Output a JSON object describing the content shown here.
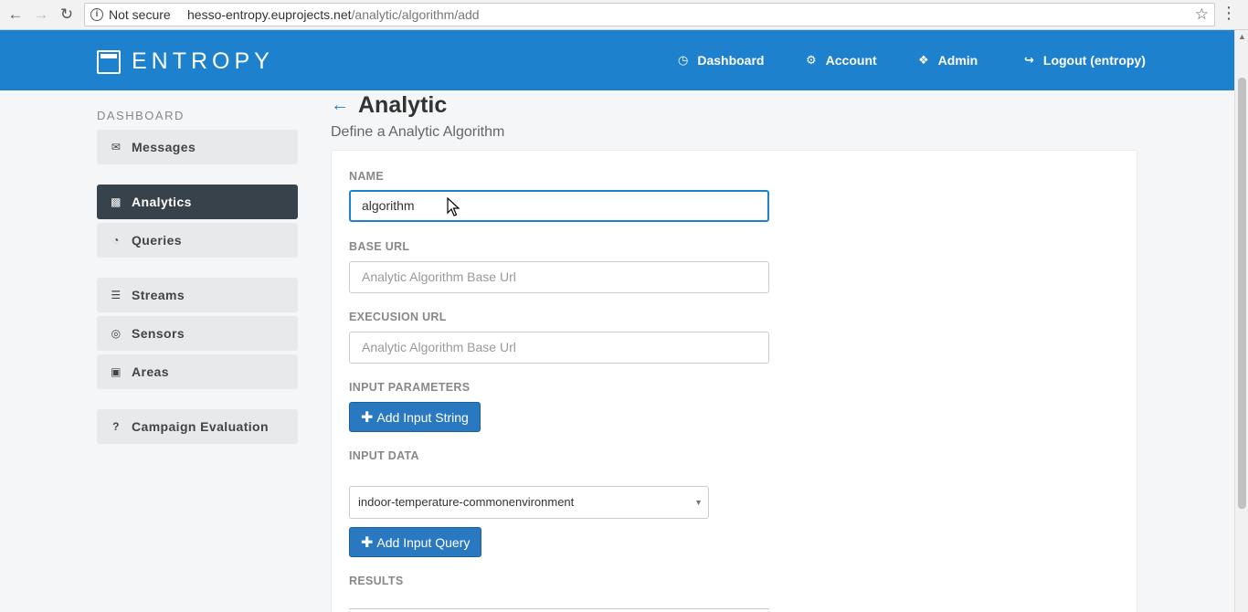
{
  "browser": {
    "security_label": "Not secure",
    "url_host": "hesso-entropy.euprojects.net",
    "url_path": "/analytic/algorithm/add"
  },
  "header": {
    "logo_text": "ENTROPY",
    "nav": {
      "dashboard": "Dashboard",
      "account": "Account",
      "admin": "Admin",
      "logout": "Logout (entropy)"
    }
  },
  "sidebar": {
    "title": "DASHBOARD",
    "items": [
      {
        "label": "Messages",
        "icon": "envelope-open-icon"
      },
      {
        "label": "Analytics",
        "icon": "bar-chart-icon",
        "active": true
      },
      {
        "label": "Queries",
        "icon": "pie-chart-icon"
      },
      {
        "label": "Streams",
        "icon": "table-icon"
      },
      {
        "label": "Sensors",
        "icon": "target-icon"
      },
      {
        "label": "Areas",
        "icon": "map-icon"
      },
      {
        "label": "Campaign Evaluation",
        "icon": "question-icon"
      }
    ]
  },
  "main": {
    "title": "Analytic",
    "subtitle": "Define a Analytic Algorithm",
    "form": {
      "name_label": "NAME",
      "name_value": "algorithm",
      "base_url_label": "BASE URL",
      "base_url_placeholder": "Analytic Algorithm Base Url",
      "execution_url_label": "EXECUSION URL",
      "execution_url_placeholder": "Analytic Algorithm Base Url",
      "input_parameters_label": "INPUT PARAMETERS",
      "add_input_string_label": "Add Input String",
      "input_data_label": "INPUT DATA",
      "input_data_selected": "indoor-temperature-commonenvironment",
      "add_input_query_label": "Add Input Query",
      "results_label": "RESULTS"
    }
  },
  "colors": {
    "header_bg": "#1e81ce",
    "sidebar_active_bg": "#37424a",
    "button_bg": "#2a79c0"
  }
}
